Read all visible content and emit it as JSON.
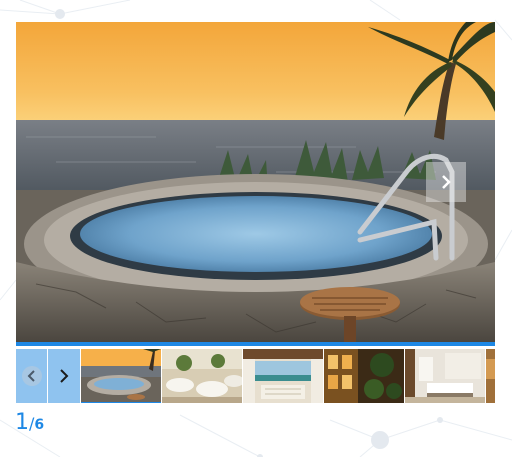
{
  "colors": {
    "accent": "#1e88e5",
    "thumb_nav_bg": "#8fc3ef",
    "counter": "#1e88e5"
  },
  "gallery": {
    "current_index": "1",
    "separator": "/",
    "total_count": "6",
    "icons": {
      "next": "chevron-right-icon",
      "prev": "chevron-left-icon"
    },
    "thumbnails": [
      {
        "name": "thumb-jacuzzi-sunset",
        "active": true
      },
      {
        "name": "thumb-banquet-hall",
        "active": false
      },
      {
        "name": "thumb-beach-terrace",
        "active": false
      },
      {
        "name": "thumb-night-courtyard",
        "active": false
      },
      {
        "name": "thumb-suite-bedroom",
        "active": false
      },
      {
        "name": "thumb-partial",
        "active": false
      }
    ]
  }
}
